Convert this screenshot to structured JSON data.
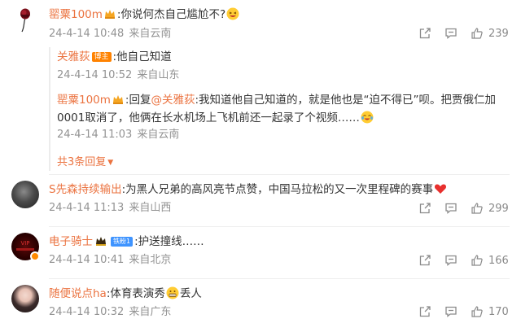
{
  "comments": [
    {
      "user": "罂粟100m",
      "text": ":你说何杰自己尴尬不?",
      "time": "24-4-14 10:48",
      "source": "来自云南",
      "likes": "239",
      "avatar": "rose-avatar",
      "replies": [
        {
          "user": "关雅荻",
          "badge": "博主",
          "text": ":他自己知道",
          "time": "24-4-14 10:52",
          "source": "来自山东"
        },
        {
          "user": "罂粟100m",
          "reply_prefix": ":回复",
          "mention": "@关雅荻",
          "text_line1": ":我知道他自己知道的，就是他也是“迫不得已”呗。把贾俄仁加",
          "text_line2": "0001取消了，他俩在长水机场上飞机前还一起录了个视频……",
          "time": "24-4-14 11:03",
          "source": "来自云南"
        }
      ],
      "more_replies": "共3条回复"
    },
    {
      "user": "S先森持续输出",
      "text": ":为黑人兄弟的高风亮节点赞，中国马拉松的又一次里程碑的赛事",
      "time": "24-4-14 11:13",
      "source": "来自山西",
      "likes": "299",
      "avatar": "dark-avatar"
    },
    {
      "user": "电子骑士",
      "badge": "铁粉1",
      "text": ":护送撞线……",
      "time": "24-4-14 10:41",
      "source": "来自北京",
      "likes": "166",
      "avatar": "red-avatar"
    },
    {
      "user": "随便说点ha",
      "text": ":体育表演秀",
      "text_after": "丢人",
      "time": "24-4-14 10:32",
      "source": "来自广东",
      "likes": "170",
      "avatar": "girl-avatar"
    }
  ],
  "colors": {
    "username": "#eb7340",
    "meta": "#939393",
    "host_badge": "#ff8200",
    "fan_badge": "#3f94ff"
  }
}
